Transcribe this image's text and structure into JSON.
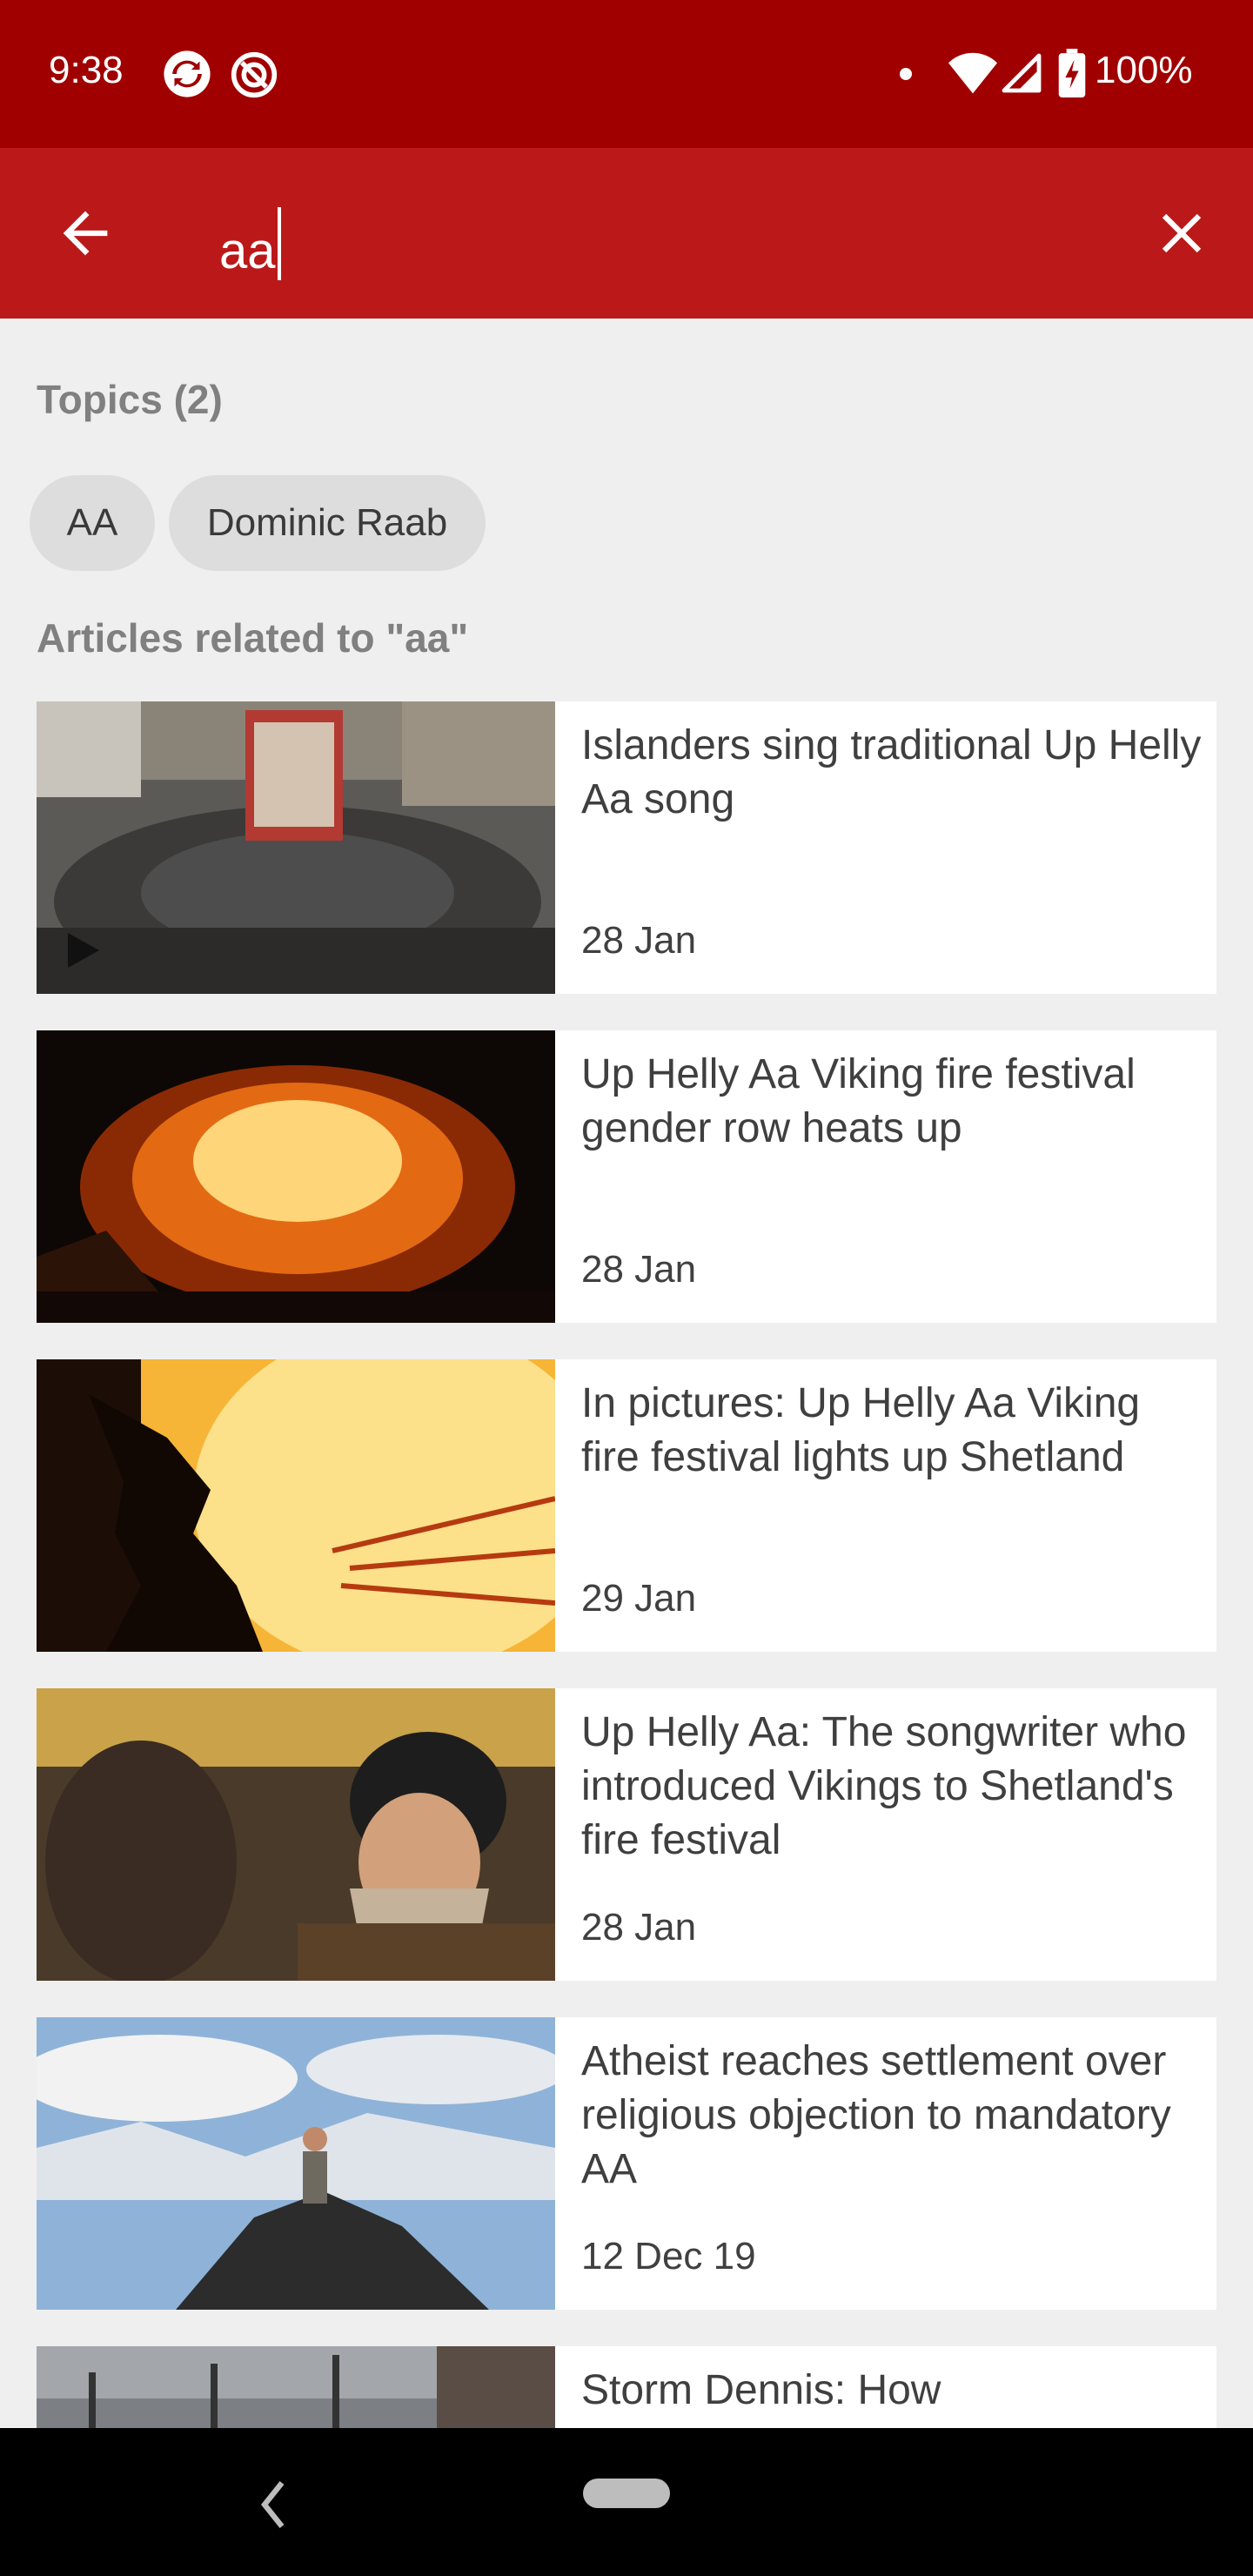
{
  "status_bar": {
    "time": "9:38",
    "battery": "100%",
    "icons": [
      "sync-icon",
      "do-not-disturb-icon",
      "notification-dot-icon",
      "wifi-icon",
      "cell-signal-icon",
      "battery-charging-icon"
    ]
  },
  "search": {
    "query": "aa",
    "back_icon": "arrow-back-icon",
    "clear_icon": "close-icon"
  },
  "topics": {
    "heading": "Topics (2)",
    "chips": [
      "AA",
      "Dominic Raab"
    ]
  },
  "articles_heading": "Articles related to \"aa\"",
  "articles": [
    {
      "title": "Islanders sing traditional Up Helly Aa song",
      "date": "28 Jan",
      "has_video": true
    },
    {
      "title": "Up Helly Aa Viking fire festival gender row heats up",
      "date": "28 Jan",
      "has_video": false
    },
    {
      "title": "In pictures: Up Helly Aa Viking fire festival lights up Shetland",
      "date": "29 Jan",
      "has_video": false
    },
    {
      "title": "Up Helly Aa: The songwriter who introduced Vikings to Shetland's fire festival",
      "date": "28 Jan",
      "has_video": false
    },
    {
      "title": "Atheist reaches settlement over religious objection to mandatory AA",
      "date": "12 Dec 19",
      "has_video": false
    },
    {
      "title": "Storm Dennis: How",
      "date": "",
      "has_video": false
    }
  ],
  "nav": {
    "icons": [
      "nav-back-icon",
      "home-pill-icon"
    ]
  },
  "colors": {
    "status_bar": "#a00000",
    "app_bar": "#bb1919",
    "background": "#efefef",
    "chip": "#dddddd"
  }
}
